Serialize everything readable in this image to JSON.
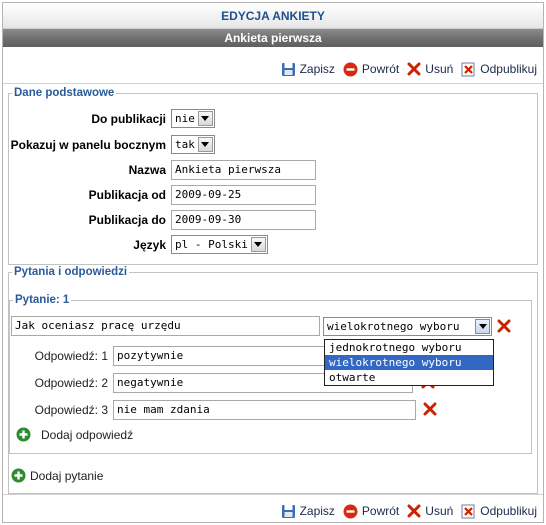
{
  "header": {
    "title": "EDYCJA ANKIETY",
    "subtitle": "Ankieta pierwsza"
  },
  "toolbar": {
    "save": "Zapisz",
    "back": "Powrót",
    "delete": "Usuń",
    "unpublish": "Odpublikuj"
  },
  "basic": {
    "legend": "Dane podstawowe",
    "published_label": "Do publikacji",
    "published_value": "nie",
    "sidebar_label": "Pokazuj w panelu bocznym",
    "sidebar_value": "tak",
    "name_label": "Nazwa",
    "name_value": "Ankieta pierwsza",
    "from_label": "Publikacja od",
    "from_value": "2009-09-25",
    "to_label": "Publikacja do",
    "to_value": "2009-09-30",
    "lang_label": "Język",
    "lang_value": "pl - Polski"
  },
  "questions": {
    "legend": "Pytania i odpowiedzi",
    "question_legend": "Pytanie: 1",
    "question_text": "Jak oceniasz pracę urzędu",
    "type_value": "wielokrotnego wyboru",
    "type_options": [
      "jednokrotnego wyboru",
      "wielokrotnego wyboru",
      "otwarte"
    ],
    "answers": [
      {
        "label": "Odpowiedź: 1",
        "value": "pozytywnie"
      },
      {
        "label": "Odpowiedź: 2",
        "value": "negatywnie"
      },
      {
        "label": "Odpowiedź: 3",
        "value": "nie mam zdania"
      }
    ],
    "add_answer": "Dodaj odpowiedź",
    "add_question": "Dodaj pytanie"
  },
  "colors": {
    "accent": "#1f4f8f",
    "delete": "#cc2200",
    "add": "#2e8b2e",
    "selected": "#3268c4"
  }
}
